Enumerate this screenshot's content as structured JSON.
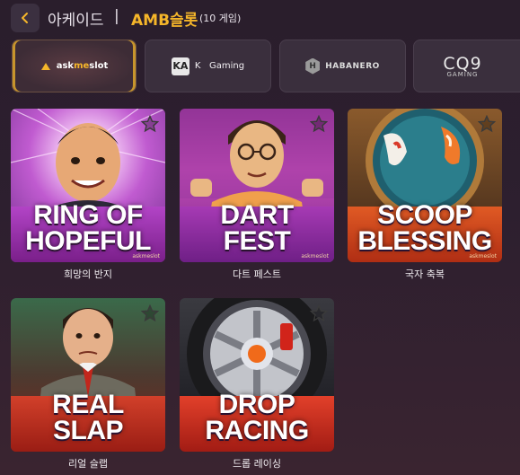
{
  "header": {
    "crumb_home": "아케이드",
    "separator": "|",
    "crumb_current": "AMB슬롯",
    "game_count": "(10 게임)"
  },
  "providers": [
    {
      "id": "askmeslot",
      "label_prefix": "ask",
      "label_accent": "me",
      "label_suffix": "slot",
      "active": true
    },
    {
      "id": "kagaming",
      "logo": "KA",
      "label": "K   Gaming",
      "active": false
    },
    {
      "id": "habanero",
      "logo": "H",
      "label": "HABANERO",
      "active": false
    },
    {
      "id": "cq9",
      "label": "CQ9",
      "sub": "GAMING",
      "active": false
    }
  ],
  "games": [
    {
      "title_line1": "RING OF",
      "title_line2": "HOPEFUL",
      "name": "희망의 반지",
      "brand": "askmeslot"
    },
    {
      "title_line1": "DART",
      "title_line2": "FEST",
      "name": "다트 페스트",
      "brand": "askmeslot"
    },
    {
      "title_line1": "SCOOP",
      "title_line2": "BLESSING",
      "name": "국자 축복",
      "brand": "askmeslot"
    },
    {
      "title_line1": "REAL",
      "title_line2": "SLAP",
      "name": "리얼 슬랩",
      "brand": ""
    },
    {
      "title_line1": "DROP",
      "title_line2": "RACING",
      "name": "드롭 레이싱",
      "brand": ""
    }
  ],
  "colors": {
    "accent": "#f5b62a",
    "background": "#2d1f2f",
    "provider_bg": "#3a2f3d"
  },
  "icons": {
    "back": "chevron-left-icon",
    "favorite": "star-outline-icon"
  }
}
